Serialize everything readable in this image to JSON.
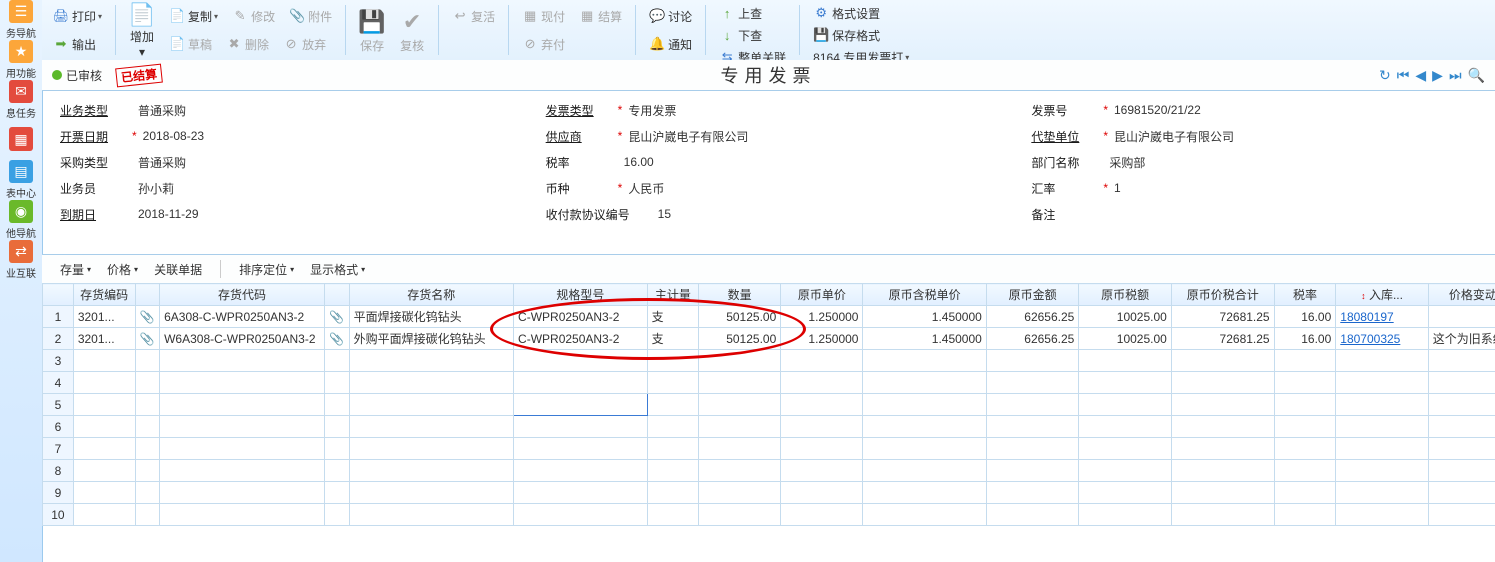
{
  "sidebar": [
    {
      "icon": "☰",
      "label": "务导航"
    },
    {
      "icon": "★",
      "label": "用功能"
    },
    {
      "icon": "✉",
      "label": "息任务"
    },
    {
      "icon": "▦",
      "label": "表中心"
    },
    {
      "icon": "◉",
      "label": "他导航"
    },
    {
      "icon": "⇄",
      "label": "业互联"
    }
  ],
  "ribbon": {
    "print": "打印",
    "output": "输出",
    "add": "增加",
    "copy": "复制",
    "draft": "草稿",
    "modify": "修改",
    "delete": "删除",
    "attach": "附件",
    "abandon": "放弃",
    "save": "保存",
    "recheck": "复核",
    "restore": "复活",
    "cash": "现付",
    "settle": "结算",
    "cashabandon": "弃付",
    "discuss": "讨论",
    "notify": "通知",
    "upload": "上查",
    "download": "下查",
    "batch": "整单关联",
    "format": "格式设置",
    "saveformat": "保存格式",
    "printtpl": "8164 专用发票打"
  },
  "status": {
    "text": "已审核",
    "stamp": "已结算",
    "title": "专用发票"
  },
  "header": {
    "c1": {
      "biz_type_lbl": "业务类型",
      "biz_type": "普通采购",
      "inv_date_lbl": "开票日期",
      "inv_date": "2018-08-23",
      "purch_type_lbl": "采购类型",
      "purch_type": "普通采购",
      "clerk_lbl": "业务员",
      "clerk": "孙小莉",
      "due_lbl": "到期日",
      "due": "2018-11-29"
    },
    "c2": {
      "inv_type_lbl": "发票类型",
      "inv_type": "专用发票",
      "supplier_lbl": "供应商",
      "supplier": "昆山沪崴电子有限公司",
      "tax_lbl": "税率",
      "tax": "16.00",
      "currency_lbl": "币种",
      "currency": "人民币",
      "pay_lbl": "收付款协议编号",
      "pay": "15"
    },
    "c3": {
      "inv_no_lbl": "发票号",
      "inv_no": "16981520/21/22",
      "agent_lbl": "代垫单位",
      "agent": "昆山沪崴电子有限公司",
      "dept_lbl": "部门名称",
      "dept": "采购部",
      "rate_lbl": "汇率",
      "rate": "1",
      "remark_lbl": "备注",
      "remark": ""
    }
  },
  "midbar": {
    "stock": "存量",
    "price": "价格",
    "related": "关联单据",
    "sort": "排序定位",
    "display": "显示格式"
  },
  "columns": [
    "",
    "存货编码",
    "",
    "存货代码",
    "",
    "存货名称",
    "规格型号",
    "主计量",
    "数量",
    "原币单价",
    "原币含税单价",
    "原币金额",
    "原币税额",
    "原币价税合计",
    "税率",
    "入库...",
    "价格变动说明"
  ],
  "rows": [
    {
      "code": "3201...",
      "alias": "6A308-C-WPR0250AN3-2",
      "name": "平面焊接碳化钨钻头",
      "spec": "C-WPR0250AN3-2",
      "uom": "支",
      "qty": "50125.00",
      "price": "1.250000",
      "taxprice": "1.450000",
      "amt": "62656.25",
      "taxamt": "10025.00",
      "total": "72681.25",
      "taxrate": "16.00",
      "inlink": "18080197",
      "note": ""
    },
    {
      "code": "3201...",
      "alias": "W6A308-C-WPR0250AN3-2",
      "name": "外购平面焊接碳化钨钻头",
      "spec": "C-WPR0250AN3-2",
      "uom": "支",
      "qty": "50125.00",
      "price": "1.250000",
      "taxprice": "1.450000",
      "amt": "62656.25",
      "taxamt": "10025.00",
      "total": "72681.25",
      "taxrate": "16.00",
      "inlink": "180700325",
      "note": "这个为旧系统..."
    }
  ],
  "icons": {
    "printer": "🖨",
    "right": "➡",
    "plus": "＋",
    "copy": "📄",
    "pen": "✎",
    "trash": "✖",
    "clip": "📎",
    "disk": "💾",
    "check": "✔",
    "undo": "↩",
    "cash": "▦",
    "chat": "💬",
    "bell": "🔔",
    "up": "↑",
    "down": "↓",
    "link": "⇆",
    "gear": "⚙",
    "save": "💾",
    "tpl": "🖶",
    "refresh": "↻",
    "first": "⏮",
    "prev": "◀",
    "next": "▶",
    "last": "⏭",
    "search": "🔍",
    "sort": "↕"
  }
}
